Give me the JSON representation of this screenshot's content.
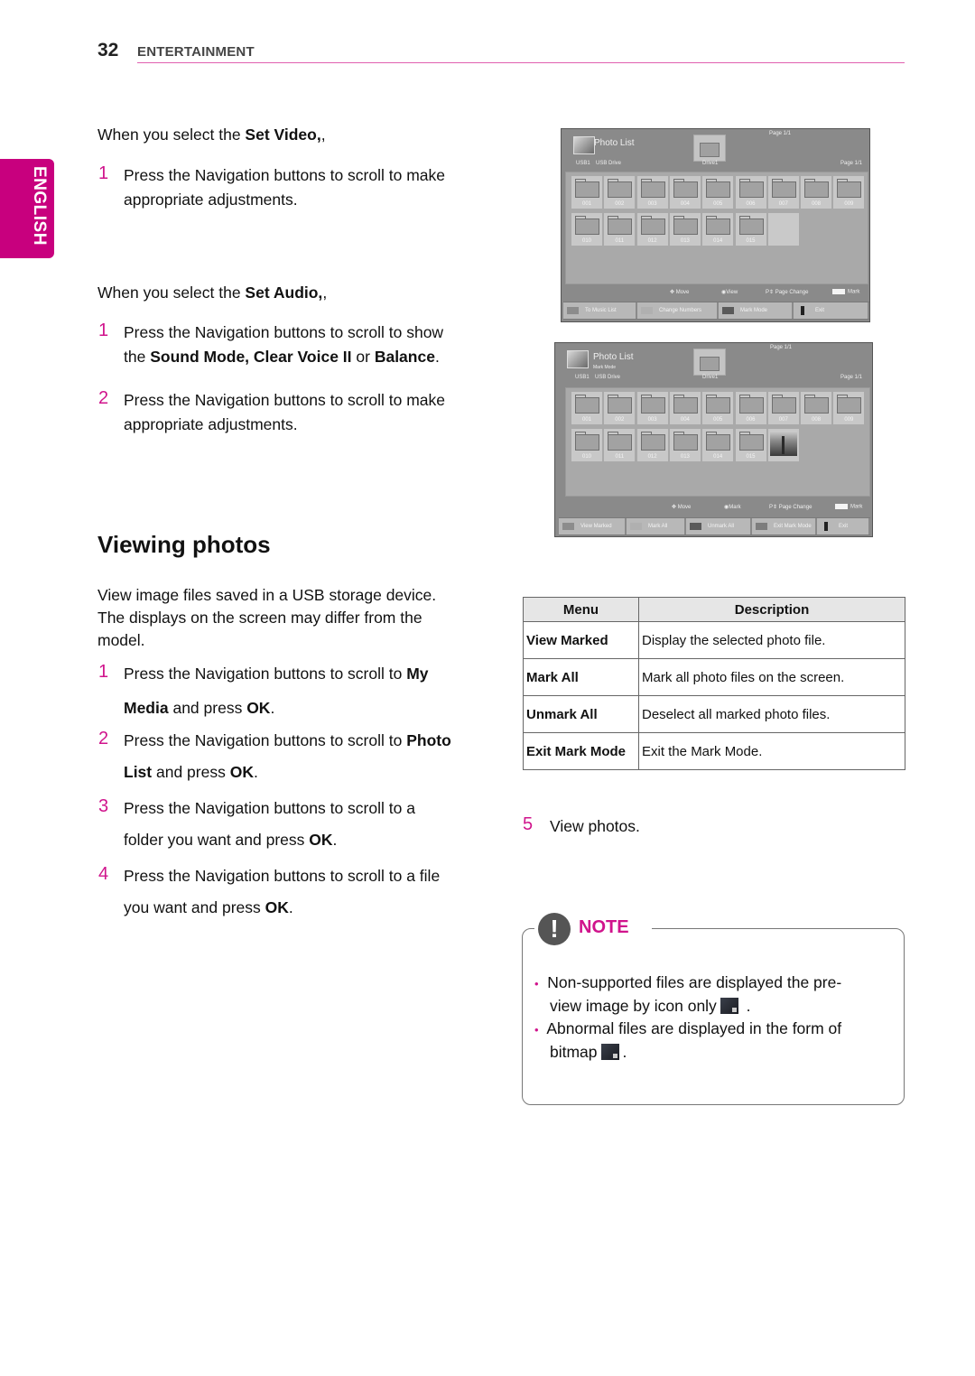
{
  "header": {
    "page_number": "32",
    "section": "ENTERTAINMENT",
    "language_tab": "ENGLISH",
    "accent_color": "#c8007e"
  },
  "set_video": {
    "intro_prefix": "When you select the ",
    "intro_bold": "Set Video,",
    "intro_suffix": ",",
    "steps": [
      {
        "num": "1",
        "line1": "Press the Navigation buttons to scroll to make",
        "line2": "appropriate adjustments."
      }
    ]
  },
  "set_audio": {
    "intro_prefix": "When you select the ",
    "intro_bold": "Set Audio,",
    "intro_suffix": ",",
    "steps": [
      {
        "num": "1",
        "line1": "Press the Navigation buttons to scroll to show",
        "line2_prefix": "the ",
        "line2_bold1": "Sound Mode, Clear Voice II",
        "line2_mid": " or ",
        "line2_bold2": "Balance",
        "line2_suffix": "."
      },
      {
        "num": "2",
        "line1": "Press the Navigation buttons to scroll to make",
        "line2": "appropriate adjustments."
      }
    ]
  },
  "viewing_photos": {
    "heading": "Viewing photos",
    "intro": [
      "View image files saved in a USB storage device.",
      "The displays on the screen may differ from the",
      "model."
    ],
    "steps": [
      {
        "num": "1",
        "a": "Press the Navigation buttons to scroll to ",
        "b": "My",
        "c": "Media",
        "d": " and press ",
        "e": "OK",
        "f": "."
      },
      {
        "num": "2",
        "a": "Press the Navigation buttons to scroll to ",
        "b": "Photo",
        "c": "List",
        "d": " and press ",
        "e": "OK",
        "f": "."
      },
      {
        "num": "3",
        "a": "Press the Navigation buttons to scroll to a",
        "c2": "folder you want and press ",
        "e": "OK",
        "f": "."
      },
      {
        "num": "4",
        "a": "Press the Navigation buttons to scroll to a file",
        "c2": "you want and press ",
        "e": "OK",
        "f": "."
      },
      {
        "num": "5",
        "a": "View photos."
      }
    ]
  },
  "tv_screen_1": {
    "title": "Photo List",
    "page_top": "Page 1/1",
    "device": "USB1",
    "drive": "USB Drive",
    "folder": "Drive1",
    "page_right": "Page 1/1",
    "folders_row1": [
      "001",
      "002",
      "003",
      "004",
      "005",
      "006",
      "007",
      "008",
      "009"
    ],
    "folders_row2": [
      "010",
      "011",
      "012",
      "013",
      "014",
      "015"
    ],
    "hints": {
      "move": "Move",
      "view": "View",
      "page_change": "Page Change",
      "mark_key": "MARK",
      "mark": "Mark"
    },
    "buttons": [
      {
        "label": "To Music List",
        "color": "#8c8c8c"
      },
      {
        "label": "Change Numbers",
        "color": "#b0b0b0"
      },
      {
        "label": "Mark Mode",
        "color": "#5a5a5a"
      },
      {
        "label": "Exit",
        "color": "#222222"
      }
    ]
  },
  "tv_screen_2": {
    "title": "Photo List",
    "subtitle": "Mark Mode",
    "page_top": "Page 1/1",
    "device": "USB1",
    "drive": "USB Drive",
    "folder": "Drive1",
    "page_right": "Page 1/1",
    "folders_row1": [
      "001",
      "002",
      "003",
      "004",
      "005",
      "006",
      "007",
      "008",
      "009"
    ],
    "folders_row2": [
      "010",
      "011",
      "012",
      "013",
      "014",
      "015"
    ],
    "hints": {
      "move": "Move",
      "mark_action": "Mark",
      "page_change": "Page Change",
      "mark_key": "MARK",
      "mark": "Mark"
    },
    "buttons": [
      {
        "label": "View Marked",
        "color": "#8c8c8c"
      },
      {
        "label": "Mark All",
        "color": "#b0b0b0"
      },
      {
        "label": "Unmark All",
        "color": "#5a5a5a"
      },
      {
        "label": "Exit Mark Mode",
        "color": "#7d7d7d"
      },
      {
        "label": "Exit",
        "color": "#222222"
      }
    ]
  },
  "menu_table": {
    "headers": [
      "Menu",
      "Description"
    ],
    "rows": [
      {
        "menu": "View Marked",
        "description": "Display the selected photo file."
      },
      {
        "menu": "Mark All",
        "description": "Mark all photo files on the screen."
      },
      {
        "menu": "Unmark All",
        "description": "Deselect all marked photo files."
      },
      {
        "menu": "Exit Mark Mode",
        "description": "Exit the Mark Mode."
      }
    ]
  },
  "note": {
    "title": "NOTE",
    "icon": "exclamation-icon",
    "items": [
      {
        "line1": "Non-supported files are displayed the pre-",
        "line2": "view image by icon only",
        "suffix": " ."
      },
      {
        "line1": "Abnormal files are displayed in the form of",
        "line2": "bitmap",
        "suffix": "."
      }
    ]
  }
}
